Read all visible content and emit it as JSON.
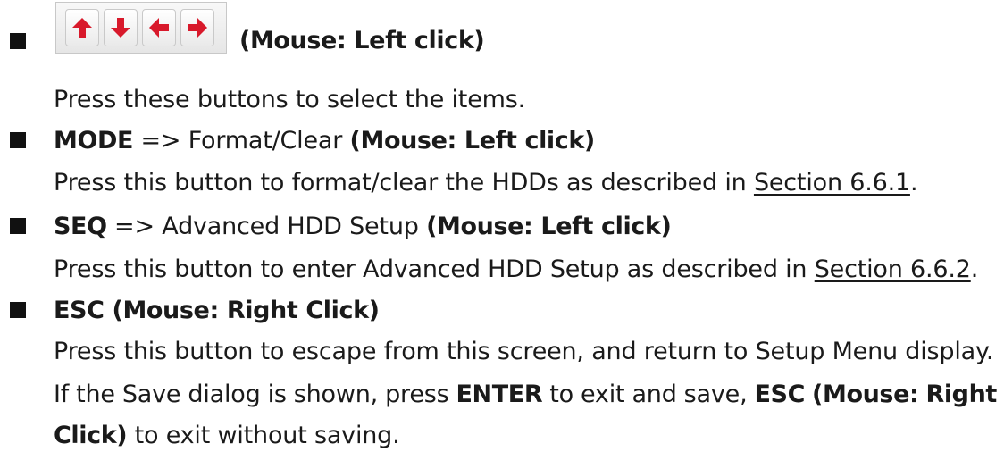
{
  "header_item": {
    "buttons": [
      {
        "icon": "up-arrow-icon"
      },
      {
        "icon": "down-arrow-icon"
      },
      {
        "icon": "left-arrow-icon"
      },
      {
        "icon": "right-arrow-icon"
      }
    ],
    "mouse_note": "(Mouse: Left click)",
    "description": "Press these buttons to select the items."
  },
  "mode_item": {
    "key": "MODE",
    "action": " => Format/Clear ",
    "mouse_note": "(Mouse: Left click)",
    "description": "Press this button to format/clear the HDDs as described in ",
    "link": "Section 6.6.1",
    "suffix": "."
  },
  "seq_item": {
    "key": "SEQ",
    "action": " => Advanced HDD Setup ",
    "mouse_note": "(Mouse: Left click)",
    "description": "Press this button to enter Advanced HDD Setup as described in ",
    "link": "Section 6.6.2",
    "suffix": "."
  },
  "esc_item": {
    "title": "ESC (Mouse: Right Click)",
    "description": "Press this button to escape from this screen, and return to Setup Menu display.",
    "save_line_1_words": [
      "If",
      "the",
      "Save",
      "dialog",
      "is",
      "shown,",
      "press"
    ],
    "enter_key": "ENTER",
    "save_line_1_mid_words": [
      "to",
      "exit",
      "and",
      "save,"
    ],
    "esc_key_part1": "ESC",
    "esc_key_part2": "(Mouse:",
    "esc_key_part3": "Right",
    "esc_key_part4": "Click)",
    "save_line_2_tail": " to exit without saving."
  },
  "colors": {
    "text": "#1a1a1a",
    "bullet": "#111111",
    "arrow_fill": "#d8192b"
  }
}
